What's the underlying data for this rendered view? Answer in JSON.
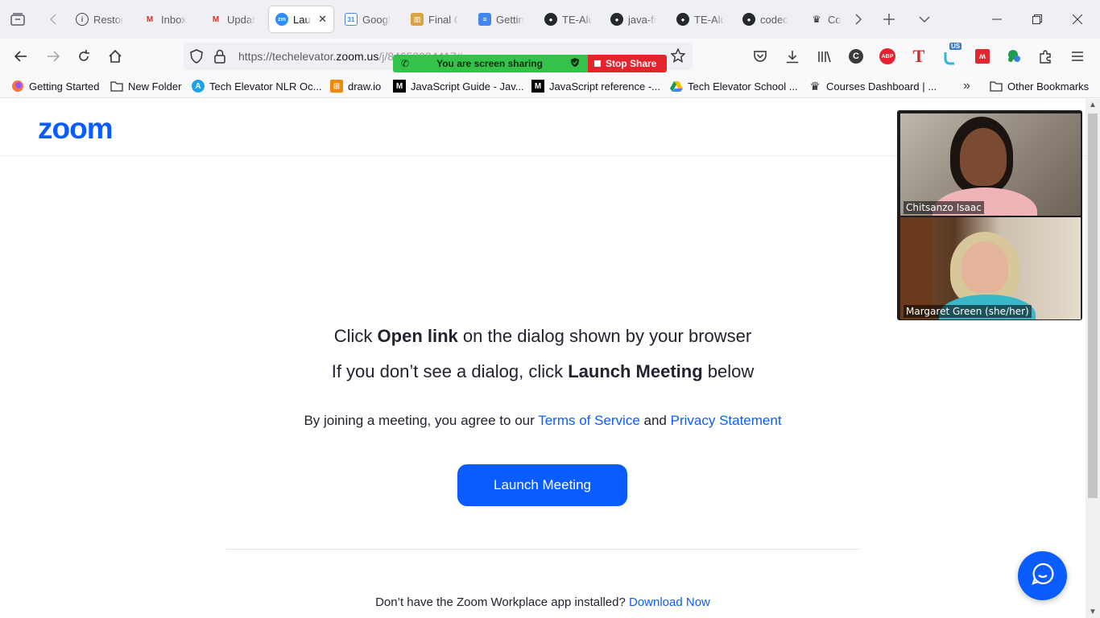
{
  "tabs": [
    {
      "label": "Restore",
      "fav": "i"
    },
    {
      "label": "Inbox",
      "fav": "M"
    },
    {
      "label": "Updat",
      "fav": "M"
    },
    {
      "label": "Lau",
      "fav": "zm"
    },
    {
      "label": "Googl",
      "fav": "31"
    },
    {
      "label": "Final C",
      "fav": "T"
    },
    {
      "label": "Gettin",
      "fav": "D"
    },
    {
      "label": "TE-Alu",
      "fav": "gh"
    },
    {
      "label": "java-fi",
      "fav": "gh"
    },
    {
      "label": "TE-Alu",
      "fav": "gh"
    },
    {
      "label": "codec",
      "fav": "gh"
    },
    {
      "label": "Cou",
      "fav": "cr"
    }
  ],
  "url": {
    "scheme": "https://techelevator.",
    "domain": "zoom.us",
    "path": "/j/84653034417#"
  },
  "screen_share": {
    "status": "You are screen sharing",
    "stop_label": "Stop Share"
  },
  "bookmarks": [
    {
      "label": "Getting Started"
    },
    {
      "label": "New Folder"
    },
    {
      "label": "Tech Elevator NLR Oc..."
    },
    {
      "label": "draw.io"
    },
    {
      "label": "JavaScript Guide - Jav..."
    },
    {
      "label": "JavaScript reference -..."
    },
    {
      "label": "Tech Elevator School ..."
    },
    {
      "label": "Courses Dashboard | ..."
    },
    {
      "label": "Other Bookmarks"
    }
  ],
  "page": {
    "logo": "zoom",
    "line1_pre": "Click ",
    "line1_bold": "Open link",
    "line1_post": " on the dialog shown by your browser",
    "line2_pre": "If you don’t see a dialog, click ",
    "line2_bold": "Launch Meeting",
    "line2_post": " below",
    "agree_pre": "By joining a meeting, you agree to our ",
    "terms_link": "Terms of Service",
    "agree_and": " and ",
    "privacy_link": "Privacy Statement",
    "launch_button": "Launch Meeting",
    "download_text": "Don’t have the Zoom Workplace app installed? ",
    "download_link": "Download Now"
  },
  "participants": [
    {
      "name": "Chitsanzo Isaac"
    },
    {
      "name": "Margaret Green (she/her)"
    }
  ],
  "extensions": {
    "us_badge": "US",
    "abp_badge": "ABP"
  },
  "colors": {
    "zoom_blue": "#0b5cff",
    "share_green": "#35c24a",
    "share_red": "#e5232c"
  }
}
